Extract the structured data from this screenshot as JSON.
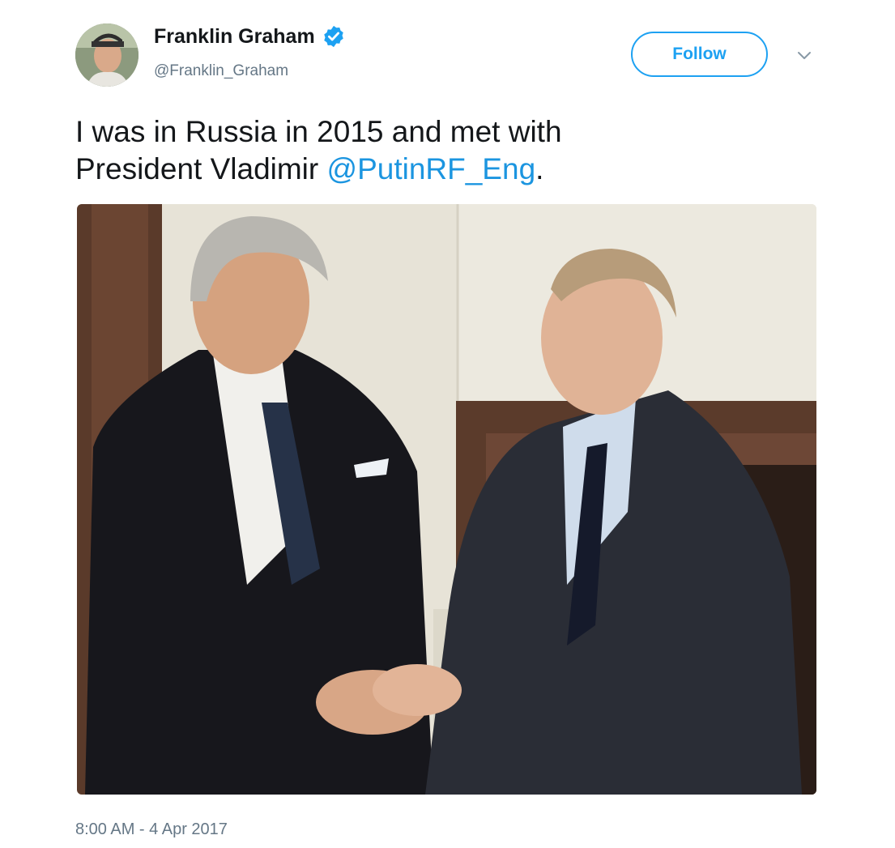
{
  "author": {
    "display_name": "Franklin Graham",
    "handle": "@Franklin_Graham",
    "verified": true
  },
  "actions": {
    "follow_label": "Follow"
  },
  "tweet": {
    "text_part1": "I was in Russia in 2015 and met with",
    "text_part2": "President Vladimir ",
    "mention": "@PutinRF_Eng",
    "text_part3": "."
  },
  "meta": {
    "timestamp": "8:00 AM - 4 Apr 2017"
  },
  "colors": {
    "accent": "#1da1f2",
    "link": "#1b95e0",
    "secondary_text": "#657786"
  },
  "icons": {
    "verified": "verified-badge-icon",
    "caret": "chevron-down-icon"
  }
}
